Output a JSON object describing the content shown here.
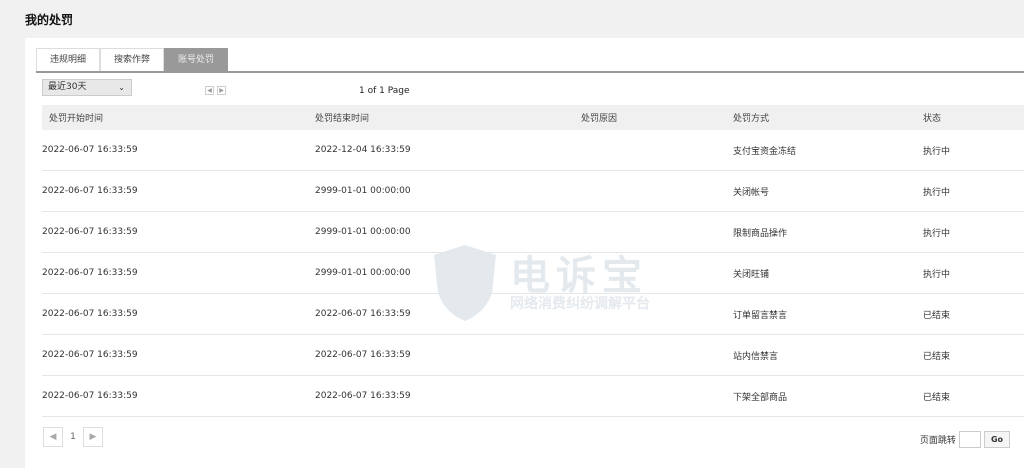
{
  "page_title": "我的处罚",
  "tabs": [
    {
      "label": "违规明细"
    },
    {
      "label": "搜索作弊"
    },
    {
      "label": "账号处罚"
    }
  ],
  "filter": {
    "selected": "最近30天"
  },
  "page_info": "1 of 1 Page",
  "table": {
    "headers": [
      "处罚开始时间",
      "处罚结束时间",
      "处罚原因",
      "处罚方式",
      "状态"
    ],
    "rows": [
      [
        "2022-06-07 16:33:59",
        "2022-12-04 16:33:59",
        "",
        "支付宝资金冻结",
        "执行中"
      ],
      [
        "2022-06-07 16:33:59",
        "2999-01-01 00:00:00",
        "",
        "关闭帐号",
        "执行中"
      ],
      [
        "2022-06-07 16:33:59",
        "2999-01-01 00:00:00",
        "",
        "限制商品操作",
        "执行中"
      ],
      [
        "2022-06-07 16:33:59",
        "2999-01-01 00:00:00",
        "",
        "关闭旺铺",
        "执行中"
      ],
      [
        "2022-06-07 16:33:59",
        "2022-06-07 16:33:59",
        "",
        "订单留言禁言",
        "已结束"
      ],
      [
        "2022-06-07 16:33:59",
        "2022-06-07 16:33:59",
        "",
        "站内信禁言",
        "已结束"
      ],
      [
        "2022-06-07 16:33:59",
        "2022-06-07 16:33:59",
        "",
        "下架全部商品",
        "已结束"
      ]
    ]
  },
  "pager": {
    "prev": "◀",
    "current": "1",
    "next": "▶",
    "jump_label": "页面跳转",
    "jump_value": "",
    "go": "Go"
  },
  "watermark": {
    "title": "电诉宝",
    "subtitle": "网络消费纠纷调解平台"
  }
}
